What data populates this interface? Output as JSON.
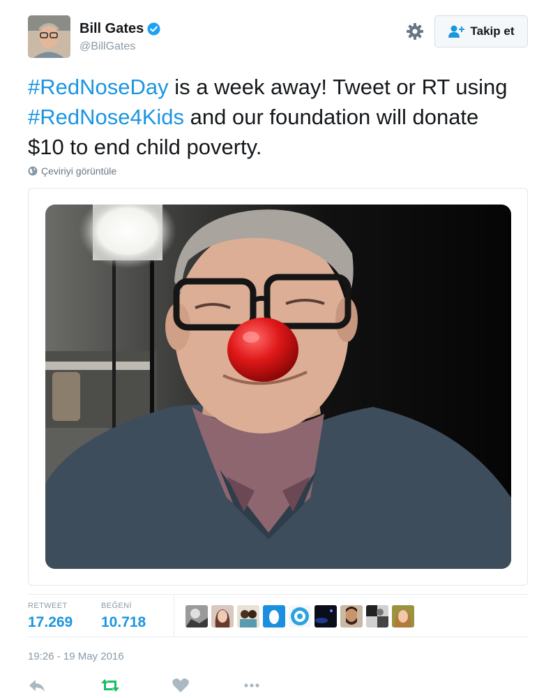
{
  "user": {
    "name": "Bill Gates",
    "handle": "@BillGates",
    "verified": true
  },
  "follow_button": {
    "label": "Takip et",
    "icon": "add-user-icon"
  },
  "tweet": {
    "hashtag1": "#RedNoseDay",
    "text1": " is a week away! Tweet or RT using ",
    "hashtag2": "#RedNose4Kids",
    "text2": " and our foundation will donate $10 to end child poverty."
  },
  "translate_label": "Çeviriyi görüntüle",
  "stats": {
    "retweet_label": "RETWEET",
    "retweet_value": "17.269",
    "like_label": "BEĞENİ",
    "like_value": "10.718"
  },
  "timestamp": "19:26 - 19 May 2016",
  "actions": [
    "reply-icon",
    "retweet-icon",
    "like-icon",
    "more-icon"
  ],
  "colors": {
    "accent": "#1b95e0",
    "retweet_green": "#17bf63",
    "muted": "#8899a6"
  }
}
